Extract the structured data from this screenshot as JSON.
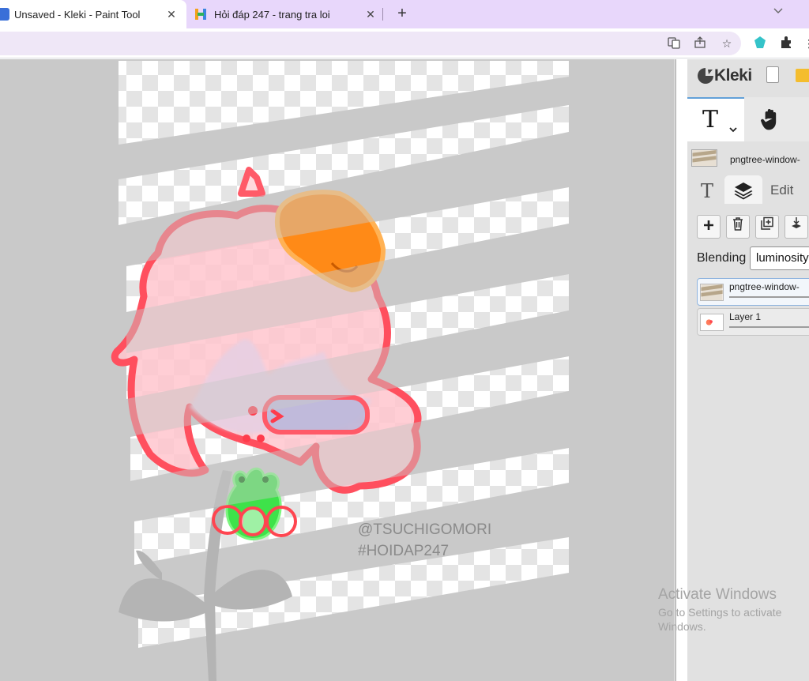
{
  "browser": {
    "tabs": [
      {
        "title": "Unsaved - Kleki - Paint Tool",
        "icon": "kleki-favicon",
        "active": true
      },
      {
        "title": "Hỏi đáp 247 - trang tra loi",
        "icon": "hoidap247-favicon",
        "active": false
      }
    ],
    "new_tab_icon": "plus-icon",
    "toolbar_icons": [
      "translate-icon",
      "share-icon",
      "bookmark-star-icon",
      "extension-gem-icon",
      "extensions-puzzle-icon",
      "more-icon"
    ]
  },
  "canvas": {
    "watermark": [
      "@TSUCHIGOMORI",
      "#HOIDAP247"
    ]
  },
  "os_overlay": {
    "activate_title": "Activate Windows",
    "activate_sub": "Go to Settings to activate Windows."
  },
  "kleki": {
    "logo_label": "Kleki",
    "active_tool": "text-tool",
    "top_layer_name": "pngtree-window-",
    "panel_tabs": {
      "text": "T",
      "edit": "Edit"
    },
    "blending_label": "Blending",
    "blending_value": "luminosity",
    "layers": [
      {
        "name": "pngtree-window-",
        "selected": true
      },
      {
        "name": "Layer 1",
        "selected": false
      }
    ]
  },
  "colors": {
    "tab_strip": "#e8d7fb",
    "canvas_background": "#c9c9c9",
    "panel_background": "#e1e1e1",
    "accent_blue": "#62a0d8"
  }
}
